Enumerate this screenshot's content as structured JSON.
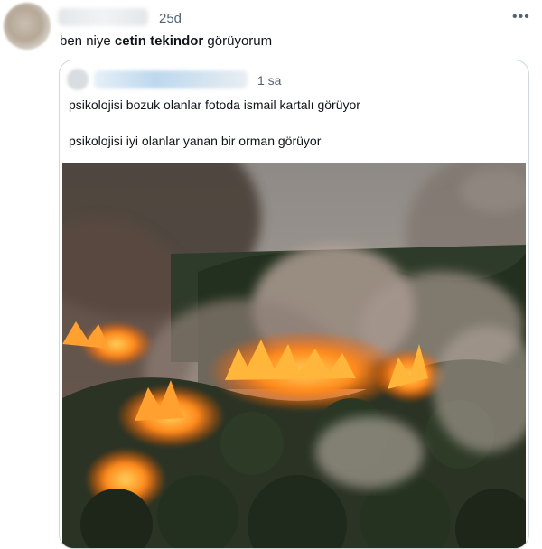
{
  "tweet": {
    "time": "25d",
    "text_prefix": "ben niye ",
    "text_bold": "cetin tekindor",
    "text_suffix": " görüyorum",
    "more_icon": "more-horizontal-icon"
  },
  "quoted_tweet": {
    "time": "1 sa",
    "line1": "psikolojisi bozuk olanlar fotoda ismail kartalı görüyor",
    "line2": "psikolojisi iyi olanlar yanan bir orman görüyor"
  }
}
